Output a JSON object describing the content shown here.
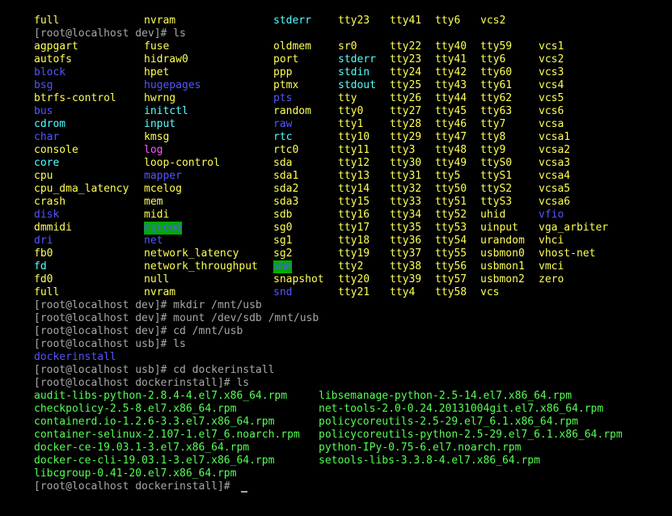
{
  "colors": {
    "background": "#000000",
    "prompt_text": "#a8a8a8",
    "char_device": "#ffff55",
    "directory": "#5555ff",
    "symlink": "#55ffff",
    "socket": "#ff55ff",
    "rpm_file": "#55ff55",
    "sticky_dir_bg": "#00aa00"
  },
  "terminal": {
    "ls_dev_partial_row": [
      "full",
      "nvram",
      "stderr",
      "tty23",
      "tty41",
      "tty6",
      "vcs2"
    ],
    "prompt_ls_dev": "[root@localhost dev]# ls",
    "dev_rows": [
      [
        "agpgart",
        "fuse",
        "oldmem",
        "sr0",
        "tty22",
        "tty40",
        "tty59",
        "vcs1"
      ],
      [
        "autofs",
        "hidraw0",
        "port",
        "stderr",
        "tty23",
        "tty41",
        "tty6",
        "vcs2"
      ],
      [
        "block",
        "hpet",
        "ppp",
        "stdin",
        "tty24",
        "tty42",
        "tty60",
        "vcs3"
      ],
      [
        "bsg",
        "hugepages",
        "ptmx",
        "stdout",
        "tty25",
        "tty43",
        "tty61",
        "vcs4"
      ],
      [
        "btrfs-control",
        "hwrng",
        "pts",
        "tty",
        "tty26",
        "tty44",
        "tty62",
        "vcs5"
      ],
      [
        "bus",
        "initctl",
        "random",
        "tty0",
        "tty27",
        "tty45",
        "tty63",
        "vcs6"
      ],
      [
        "cdrom",
        "input",
        "raw",
        "tty1",
        "tty28",
        "tty46",
        "tty7",
        "vcsa"
      ],
      [
        "char",
        "kmsg",
        "rtc",
        "tty10",
        "tty29",
        "tty47",
        "tty8",
        "vcsa1"
      ],
      [
        "console",
        "log",
        "rtc0",
        "tty11",
        "tty3",
        "tty48",
        "tty9",
        "vcsa2"
      ],
      [
        "core",
        "loop-control",
        "sda",
        "tty12",
        "tty30",
        "tty49",
        "ttyS0",
        "vcsa3"
      ],
      [
        "cpu",
        "mapper",
        "sda1",
        "tty13",
        "tty31",
        "tty5",
        "ttyS1",
        "vcsa4"
      ],
      [
        "cpu_dma_latency",
        "mcelog",
        "sda2",
        "tty14",
        "tty32",
        "tty50",
        "ttyS2",
        "vcsa5"
      ],
      [
        "crash",
        "mem",
        "sda3",
        "tty15",
        "tty33",
        "tty51",
        "ttyS3",
        "vcsa6"
      ],
      [
        "disk",
        "midi",
        "sdb",
        "tty16",
        "tty34",
        "tty52",
        "uhid",
        "vfio"
      ],
      [
        "dmmidi",
        "mqueue",
        "sg0",
        "tty17",
        "tty35",
        "tty53",
        "uinput",
        "vga_arbiter"
      ],
      [
        "dri",
        "net",
        "sg1",
        "tty18",
        "tty36",
        "tty54",
        "urandom",
        "vhci"
      ],
      [
        "fb0",
        "network_latency",
        "sg2",
        "tty19",
        "tty37",
        "tty55",
        "usbmon0",
        "vhost-net"
      ],
      [
        "fd",
        "network_throughput",
        "shm",
        "tty2",
        "tty38",
        "tty56",
        "usbmon1",
        "vmci"
      ],
      [
        "fd0",
        "null",
        "snapshot",
        "tty20",
        "tty39",
        "tty57",
        "usbmon2",
        "zero"
      ],
      [
        "full",
        "nvram",
        "snd",
        "tty21",
        "tty4",
        "tty58",
        "vcs",
        ""
      ]
    ],
    "prompt_mkdir": "[root@localhost dev]# mkdir /mnt/usb",
    "prompt_mount": "[root@localhost dev]# mount /dev/sdb /mnt/usb",
    "prompt_cd_usb": "[root@localhost dev]# cd /mnt/usb",
    "prompt_ls_usb": "[root@localhost usb]# ls",
    "usb_listing": "dockerinstall",
    "prompt_cd_docker": "[root@localhost usb]# cd dockerinstall",
    "prompt_ls_docker": "[root@localhost dockerinstall]# ls",
    "rpm_rows": [
      [
        "audit-libs-python-2.8.4-4.el7.x86_64.rpm",
        "libsemanage-python-2.5-14.el7.x86_64.rpm"
      ],
      [
        "checkpolicy-2.5-8.el7.x86_64.rpm",
        "net-tools-2.0-0.24.20131004git.el7.x86_64.rpm"
      ],
      [
        "containerd.io-1.2.6-3.3.el7.x86_64.rpm",
        "policycoreutils-2.5-29.el7_6.1.x86_64.rpm"
      ],
      [
        "container-selinux-2.107-1.el7_6.noarch.rpm",
        "policycoreutils-python-2.5-29.el7_6.1.x86_64.rpm"
      ],
      [
        "docker-ce-19.03.1-3.el7.x86_64.rpm",
        "python-IPy-0.75-6.el7.noarch.rpm"
      ],
      [
        "docker-ce-cli-19.03.1-3.el7.x86_64.rpm",
        "setools-libs-3.3.8-4.el7.x86_64.rpm"
      ],
      [
        "libcgroup-0.41-20.el7.x86_64.rpm",
        ""
      ]
    ],
    "final_prompt": "[root@localhost dockerinstall]# "
  }
}
